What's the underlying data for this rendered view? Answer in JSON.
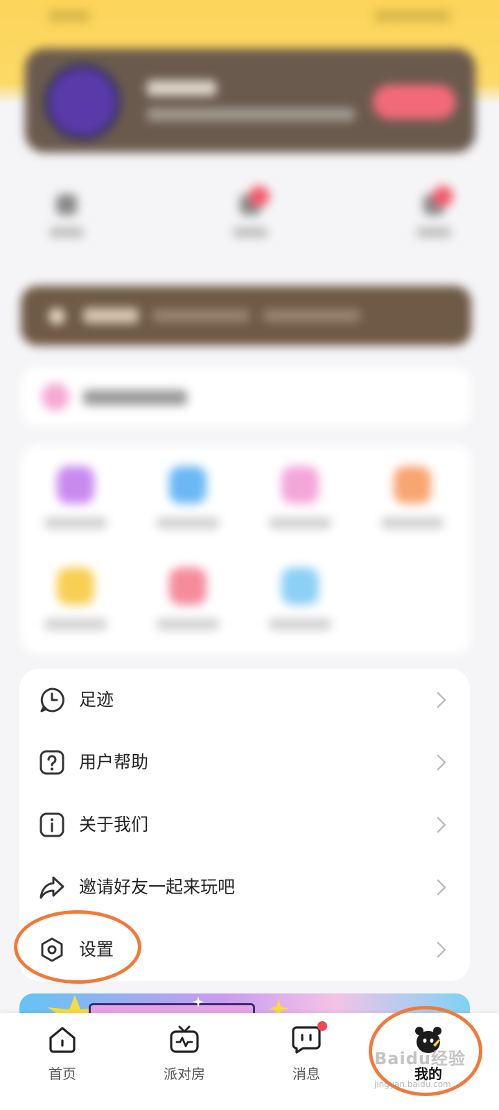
{
  "colors": {
    "header_bg": "#fcd55a",
    "accent_ring": "#f07a3a",
    "notification_dot": "#f04855",
    "page_bg": "#f5f5f7"
  },
  "menu": {
    "items": [
      {
        "label": "足迹",
        "icon": "clock-chat-icon"
      },
      {
        "label": "用户帮助",
        "icon": "question-icon"
      },
      {
        "label": "关于我们",
        "icon": "info-icon"
      },
      {
        "label": "邀请好友一起来玩吧",
        "icon": "share-icon"
      },
      {
        "label": "设置",
        "icon": "settings-icon"
      }
    ]
  },
  "tabs": [
    {
      "label": "首页",
      "icon": "home-icon"
    },
    {
      "label": "派对房",
      "icon": "tv-icon"
    },
    {
      "label": "消息",
      "icon": "message-icon",
      "has_badge": true
    },
    {
      "label": "我的",
      "icon": "avatar-icon",
      "active": true
    }
  ],
  "watermark": {
    "text": "Baidu经验",
    "sub": "jingyan.baidu.com"
  }
}
